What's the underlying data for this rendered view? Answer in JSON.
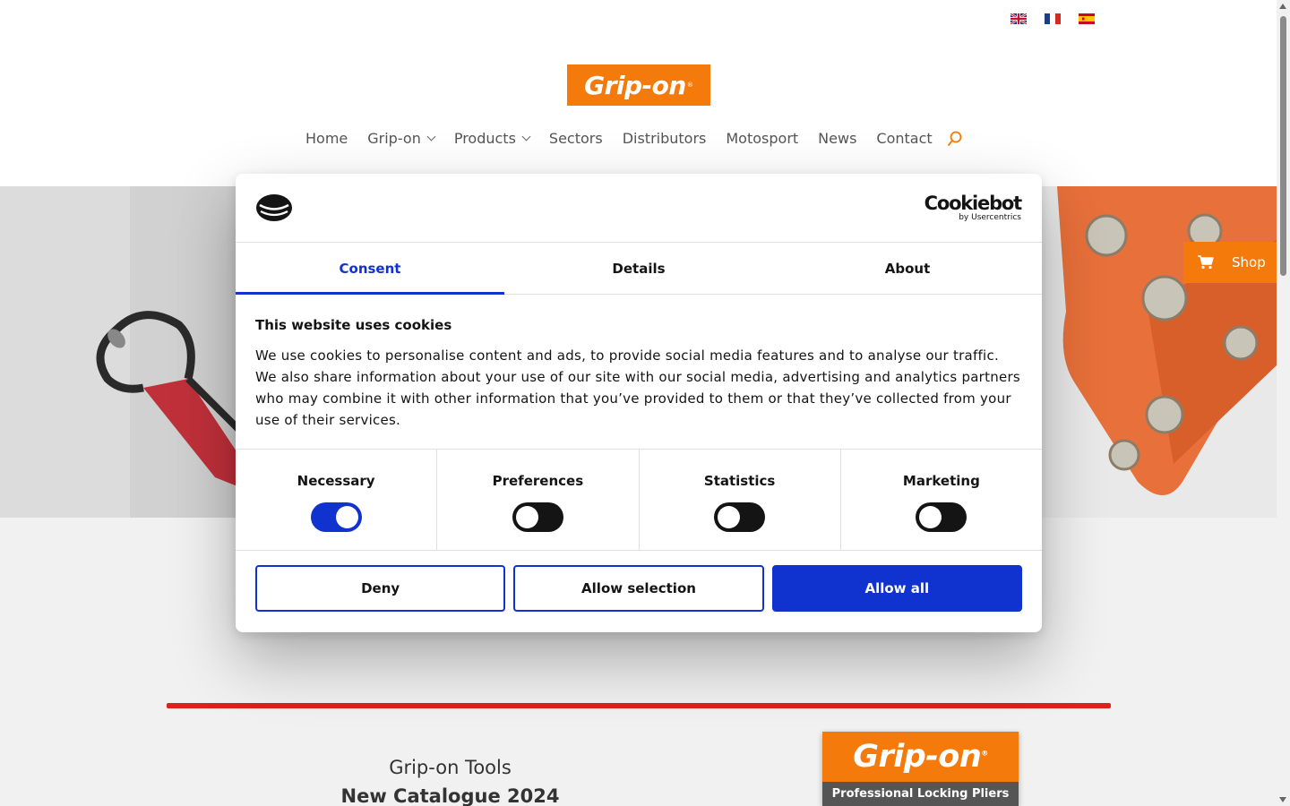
{
  "header": {
    "languages": [
      "English",
      "Français",
      "Español"
    ],
    "logo_text": "Grip-on",
    "logo_reg": "®",
    "nav": [
      {
        "label": "Home",
        "has_dropdown": false
      },
      {
        "label": "Grip-on",
        "has_dropdown": true
      },
      {
        "label": "Products",
        "has_dropdown": true
      },
      {
        "label": "Sectors",
        "has_dropdown": false
      },
      {
        "label": "Distributors",
        "has_dropdown": false
      },
      {
        "label": "Motosport",
        "has_dropdown": false
      },
      {
        "label": "News",
        "has_dropdown": false
      },
      {
        "label": "Contact",
        "has_dropdown": false
      }
    ],
    "search_icon": "search-icon",
    "accent_color": "#f47a0b"
  },
  "shop": {
    "label": "Shop",
    "icon": "cart-icon"
  },
  "catalogue": {
    "line1": "Grip-on Tools",
    "line2": "New Catalogue 2024",
    "cover_brand": "Grip-on",
    "cover_reg": "®",
    "cover_subtitle": "Professional Locking Pliers"
  },
  "cookie_dialog": {
    "brand_name": "Cookiebot",
    "brand_by": "by Usercentrics",
    "tabs": [
      {
        "label": "Consent",
        "active": true
      },
      {
        "label": "Details",
        "active": false
      },
      {
        "label": "About",
        "active": false
      }
    ],
    "heading": "This website uses cookies",
    "text": "We use cookies to personalise content and ads, to provide social media features and to analyse our traffic. We also share information about your use of our site with our social media, advertising and analytics partners who may combine it with other information that you’ve provided to them or that they’ve collected from your use of their services.",
    "toggles": [
      {
        "label": "Necessary",
        "on": true
      },
      {
        "label": "Preferences",
        "on": false
      },
      {
        "label": "Statistics",
        "on": false
      },
      {
        "label": "Marketing",
        "on": false
      }
    ],
    "buttons": {
      "deny": "Deny",
      "allow_selection": "Allow selection",
      "allow_all": "Allow all"
    },
    "accent_color": "#1032cf"
  }
}
